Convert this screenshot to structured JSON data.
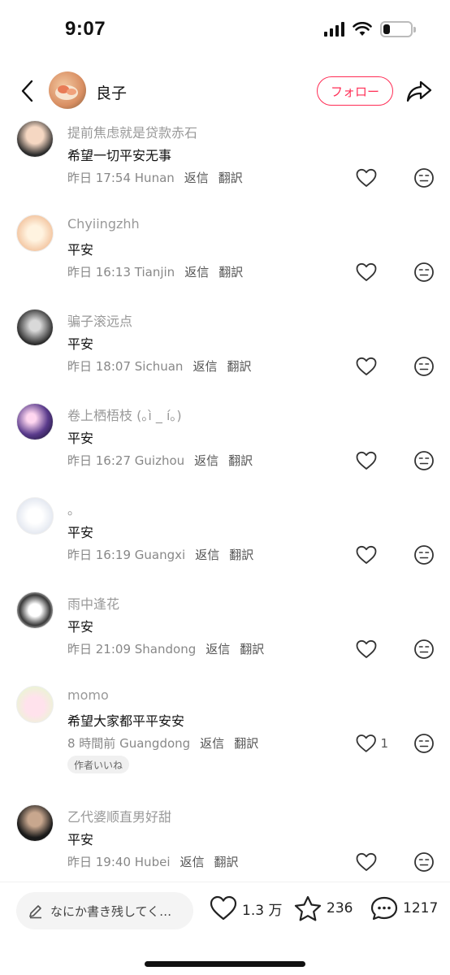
{
  "status_bar": {
    "time": "9:07",
    "battery_level": 0.25
  },
  "header": {
    "username": "良子",
    "follow_label": "フォロー"
  },
  "comments": [
    {
      "name": "提前焦虑就是贷款赤石",
      "text": "希望一切平安无事",
      "date": "昨日 17:54",
      "location": "Hunan",
      "reply": "返信",
      "translate": "翻訳",
      "likes": "",
      "author_liked": ""
    },
    {
      "name": "Chyiingzhh",
      "text": "平安",
      "date": "昨日 16:13",
      "location": "Tianjin",
      "reply": "返信",
      "translate": "翻訳",
      "likes": "",
      "author_liked": ""
    },
    {
      "name": "骗子滚远点",
      "text": "平安",
      "date": "昨日 18:07",
      "location": "Sichuan",
      "reply": "返信",
      "translate": "翻訳",
      "likes": "",
      "author_liked": ""
    },
    {
      "name": "卷上栖梧枝 (｡ì _ í｡)",
      "text": "平安",
      "date": "昨日 16:27",
      "location": "Guizhou",
      "reply": "返信",
      "translate": "翻訳",
      "likes": "",
      "author_liked": ""
    },
    {
      "name": "。",
      "text": "平安",
      "date": "昨日 16:19",
      "location": "Guangxi",
      "reply": "返信",
      "translate": "翻訳",
      "likes": "",
      "author_liked": ""
    },
    {
      "name": "雨中逢花",
      "text": "平安",
      "date": "昨日 21:09",
      "location": "Shandong",
      "reply": "返信",
      "translate": "翻訳",
      "likes": "",
      "author_liked": ""
    },
    {
      "name": "momo",
      "text": "希望大家都平平安安",
      "date": "8 時間前",
      "location": "Guangdong",
      "reply": "返信",
      "translate": "翻訳",
      "likes": "1",
      "author_liked": "作者いいね"
    },
    {
      "name": "乙代婆顺直男好甜",
      "text": "平安",
      "date": "昨日 19:40",
      "location": "Hubei",
      "reply": "返信",
      "translate": "翻訳",
      "likes": "",
      "author_liked": ""
    }
  ],
  "bottom_bar": {
    "input_placeholder": "なにか書き残してく…",
    "likes": "1.3 万",
    "stars": "236",
    "comments": "1217"
  },
  "colors": {
    "accent": "#ff2d55",
    "muted_text": "#999999"
  }
}
